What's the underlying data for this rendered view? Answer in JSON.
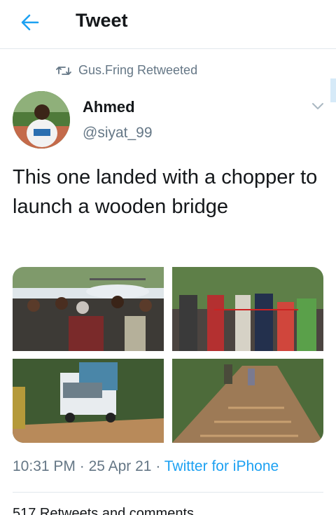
{
  "header": {
    "title": "Tweet",
    "back_icon": "arrow-left-icon",
    "accent": "#1da1f2"
  },
  "retweet_context": {
    "icon": "retweet-icon",
    "text": "Gus.Fring Retweeted"
  },
  "tweet": {
    "author_name": "Ahmed",
    "author_handle": "@siyat_99",
    "text": "This one landed with a chopper to launch a wooden bridge",
    "images": [
      {
        "alt": "crowd-near-helicopter"
      },
      {
        "alt": "officials-cutting-ribbon"
      },
      {
        "alt": "truck-on-wooden-bridge"
      },
      {
        "alt": "people-walking-on-wooden-bridge"
      }
    ],
    "time": "10:31 PM",
    "date": "25 Apr 21",
    "source": "Twitter for iPhone",
    "stats_partial": "517 Retweets and comments"
  },
  "colors": {
    "text": "#14171a",
    "secondary": "#657786",
    "link": "#1da1f2",
    "divider": "#e1e8ed"
  }
}
